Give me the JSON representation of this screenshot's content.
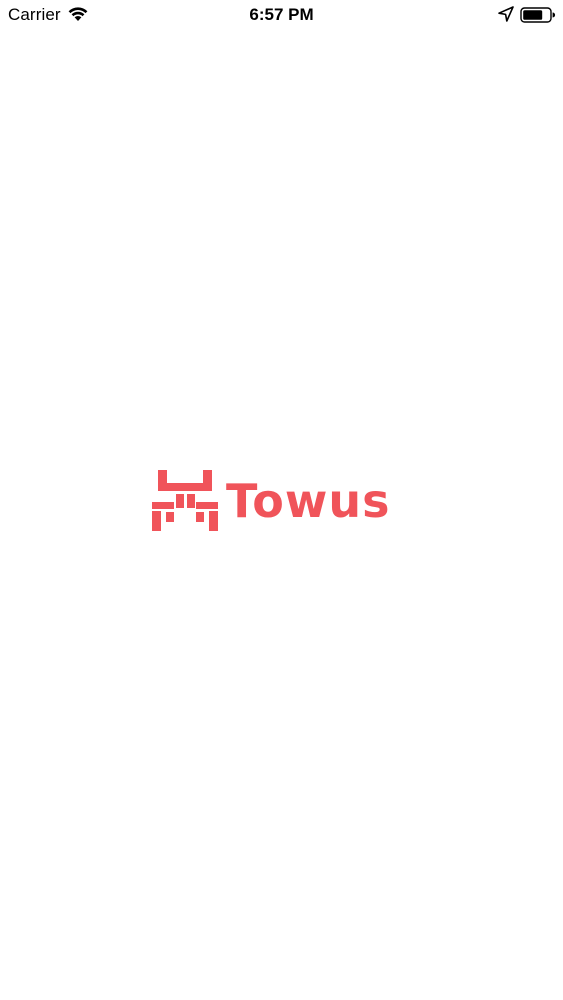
{
  "status_bar": {
    "carrier": "Carrier",
    "time": "6:57 PM",
    "icons": [
      "wifi-icon",
      "location-arrow-icon",
      "battery-icon"
    ]
  },
  "splash": {
    "brand_name": "Towus",
    "brand_color": "#f0545a"
  }
}
